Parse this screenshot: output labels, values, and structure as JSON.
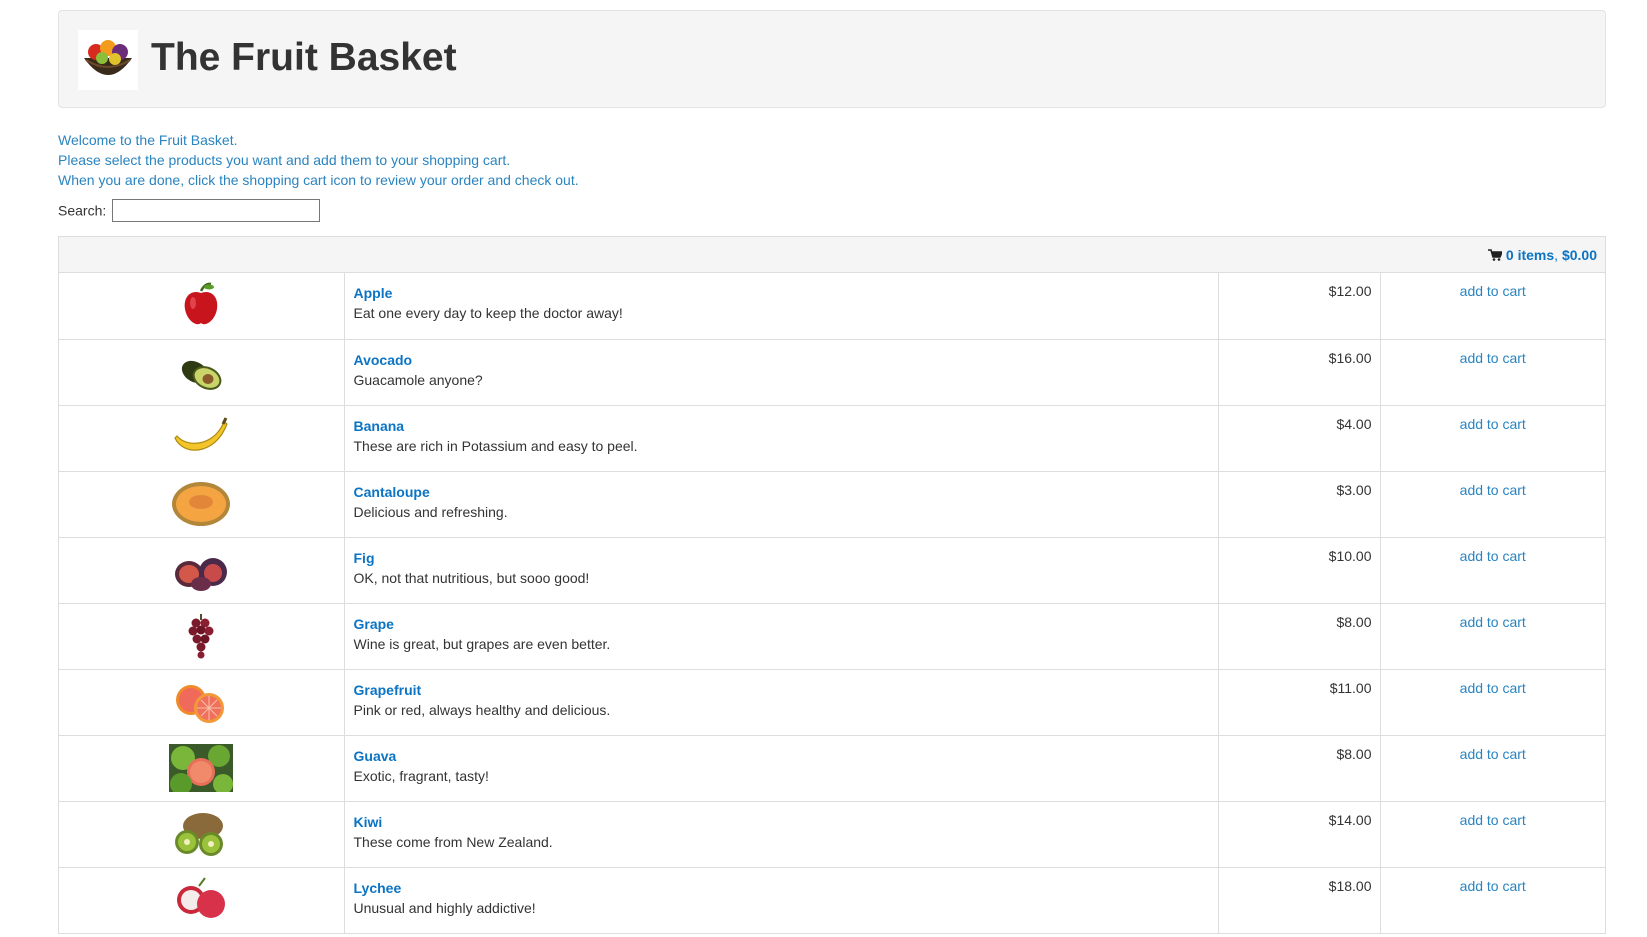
{
  "header": {
    "title": "The Fruit Basket",
    "logo_icon": "fruit-basket-logo"
  },
  "intro": {
    "line1": "Welcome to the Fruit Basket.",
    "line2": "Please select the products you want and add them to your shopping cart.",
    "line3": "When you are done, click the shopping cart icon to review your order and check out."
  },
  "search": {
    "label": "Search:",
    "value": ""
  },
  "cart": {
    "icon": "shopping-cart-icon",
    "items_label": "0 items",
    "separator": ",",
    "total": "$0.00"
  },
  "colors": {
    "link": "#0b74c4",
    "intro": "#2a84c0",
    "header_bg": "#f5f5f5",
    "border": "#dddddd"
  },
  "products": [
    {
      "name": "Apple",
      "description": "Eat one every day to keep the doctor away!",
      "price": "$12.00",
      "action": "add to cart",
      "icon": "apple-icon"
    },
    {
      "name": "Avocado",
      "description": "Guacamole anyone?",
      "price": "$16.00",
      "action": "add to cart",
      "icon": "avocado-icon"
    },
    {
      "name": "Banana",
      "description": "These are rich in Potassium and easy to peel.",
      "price": "$4.00",
      "action": "add to cart",
      "icon": "banana-icon"
    },
    {
      "name": "Cantaloupe",
      "description": "Delicious and refreshing.",
      "price": "$3.00",
      "action": "add to cart",
      "icon": "cantaloupe-icon"
    },
    {
      "name": "Fig",
      "description": "OK, not that nutritious, but sooo good!",
      "price": "$10.00",
      "action": "add to cart",
      "icon": "fig-icon"
    },
    {
      "name": "Grape",
      "description": "Wine is great, but grapes are even better.",
      "price": "$8.00",
      "action": "add to cart",
      "icon": "grape-icon"
    },
    {
      "name": "Grapefruit",
      "description": "Pink or red, always healthy and delicious.",
      "price": "$11.00",
      "action": "add to cart",
      "icon": "grapefruit-icon"
    },
    {
      "name": "Guava",
      "description": "Exotic, fragrant, tasty!",
      "price": "$8.00",
      "action": "add to cart",
      "icon": "guava-icon"
    },
    {
      "name": "Kiwi",
      "description": "These come from New Zealand.",
      "price": "$14.00",
      "action": "add to cart",
      "icon": "kiwi-icon"
    },
    {
      "name": "Lychee",
      "description": "Unusual and highly addictive!",
      "price": "$18.00",
      "action": "add to cart",
      "icon": "lychee-icon"
    }
  ]
}
